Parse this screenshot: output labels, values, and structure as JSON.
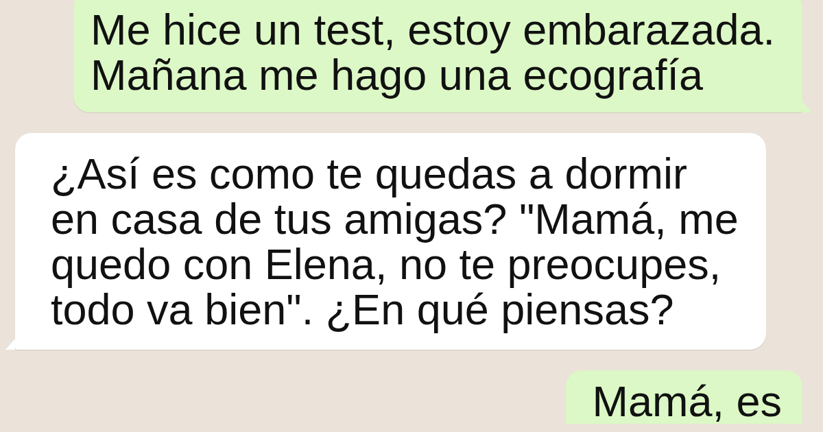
{
  "messages": [
    {
      "kind": "outgoing",
      "tail": true,
      "text": "Me hice un test, estoy embarazada.\nMañana me hago una ecografía"
    },
    {
      "kind": "incoming",
      "tail": true,
      "text": "¿Así es como te quedas a dormir\nen casa de tus amigas? \"Mamá, me\nquedo con Elena, no te preocupes,\ntodo va bien\". ¿En qué piensas?"
    },
    {
      "kind": "outgoing",
      "text": "Mamá, es"
    }
  ]
}
